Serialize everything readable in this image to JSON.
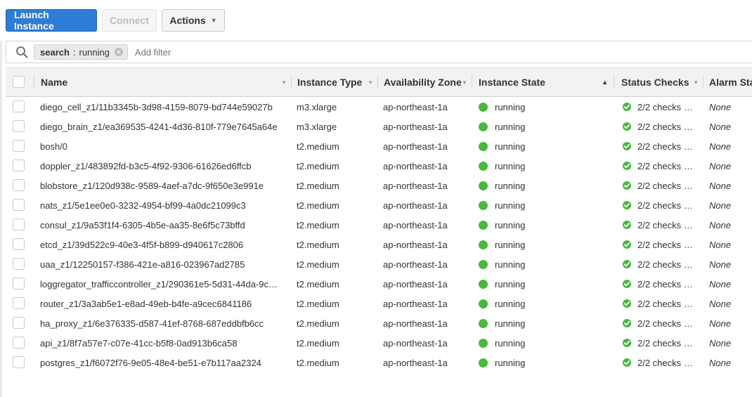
{
  "toolbar": {
    "launch_label": "Launch Instance",
    "connect_label": "Connect",
    "actions_label": "Actions"
  },
  "filter": {
    "chip_key": "search",
    "chip_separator": ":",
    "chip_value": "running",
    "placeholder": "Add filter"
  },
  "columns": {
    "name": "Name",
    "instance_type": "Instance Type",
    "availability_zone": "Availability Zone",
    "instance_state": "Instance State",
    "status_checks": "Status Checks",
    "alarm_status": "Alarm Sta"
  },
  "colors": {
    "primary": "#2f7cd6",
    "running": "#48b83e"
  },
  "rows": [
    {
      "name": "diego_cell_z1/11b3345b-3d98-4159-8079-bd744e59027b",
      "type": "m3.xlarge",
      "zone": "ap-northeast-1a",
      "state": "running",
      "checks": "2/2 checks …",
      "alarm": "None"
    },
    {
      "name": "diego_brain_z1/ea369535-4241-4d36-810f-779e7645a64e",
      "type": "m3.xlarge",
      "zone": "ap-northeast-1a",
      "state": "running",
      "checks": "2/2 checks …",
      "alarm": "None"
    },
    {
      "name": "bosh/0",
      "type": "t2.medium",
      "zone": "ap-northeast-1a",
      "state": "running",
      "checks": "2/2 checks …",
      "alarm": "None"
    },
    {
      "name": "doppler_z1/483892fd-b3c5-4f92-9306-61626ed6ffcb",
      "type": "t2.medium",
      "zone": "ap-northeast-1a",
      "state": "running",
      "checks": "2/2 checks …",
      "alarm": "None"
    },
    {
      "name": "blobstore_z1/120d938c-9589-4aef-a7dc-9f650e3e991e",
      "type": "t2.medium",
      "zone": "ap-northeast-1a",
      "state": "running",
      "checks": "2/2 checks …",
      "alarm": "None"
    },
    {
      "name": "nats_z1/5e1ee0e0-3232-4954-bf99-4a0dc21099c3",
      "type": "t2.medium",
      "zone": "ap-northeast-1a",
      "state": "running",
      "checks": "2/2 checks …",
      "alarm": "None"
    },
    {
      "name": "consul_z1/9a53f1f4-6305-4b5e-aa35-8e6f5c73bffd",
      "type": "t2.medium",
      "zone": "ap-northeast-1a",
      "state": "running",
      "checks": "2/2 checks …",
      "alarm": "None"
    },
    {
      "name": "etcd_z1/39d522c9-40e3-4f5f-b899-d940617c2806",
      "type": "t2.medium",
      "zone": "ap-northeast-1a",
      "state": "running",
      "checks": "2/2 checks …",
      "alarm": "None"
    },
    {
      "name": "uaa_z1/12250157-f386-421e-a816-023967ad2785",
      "type": "t2.medium",
      "zone": "ap-northeast-1a",
      "state": "running",
      "checks": "2/2 checks …",
      "alarm": "None"
    },
    {
      "name": "loggregator_trafficcontroller_z1/290361e5-5d31-44da-9c…",
      "type": "t2.medium",
      "zone": "ap-northeast-1a",
      "state": "running",
      "checks": "2/2 checks …",
      "alarm": "None"
    },
    {
      "name": "router_z1/3a3ab5e1-e8ad-49eb-b4fe-a9cec6841186",
      "type": "t2.medium",
      "zone": "ap-northeast-1a",
      "state": "running",
      "checks": "2/2 checks …",
      "alarm": "None"
    },
    {
      "name": "ha_proxy_z1/6e376335-d587-41ef-8768-687eddbfb6cc",
      "type": "t2.medium",
      "zone": "ap-northeast-1a",
      "state": "running",
      "checks": "2/2 checks …",
      "alarm": "None"
    },
    {
      "name": "api_z1/8f7a57e7-c07e-41cc-b5f8-0ad913b6ca58",
      "type": "t2.medium",
      "zone": "ap-northeast-1a",
      "state": "running",
      "checks": "2/2 checks …",
      "alarm": "None"
    },
    {
      "name": "postgres_z1/f6072f76-9e05-48e4-be51-e7b117aa2324",
      "type": "t2.medium",
      "zone": "ap-northeast-1a",
      "state": "running",
      "checks": "2/2 checks …",
      "alarm": "None"
    }
  ]
}
